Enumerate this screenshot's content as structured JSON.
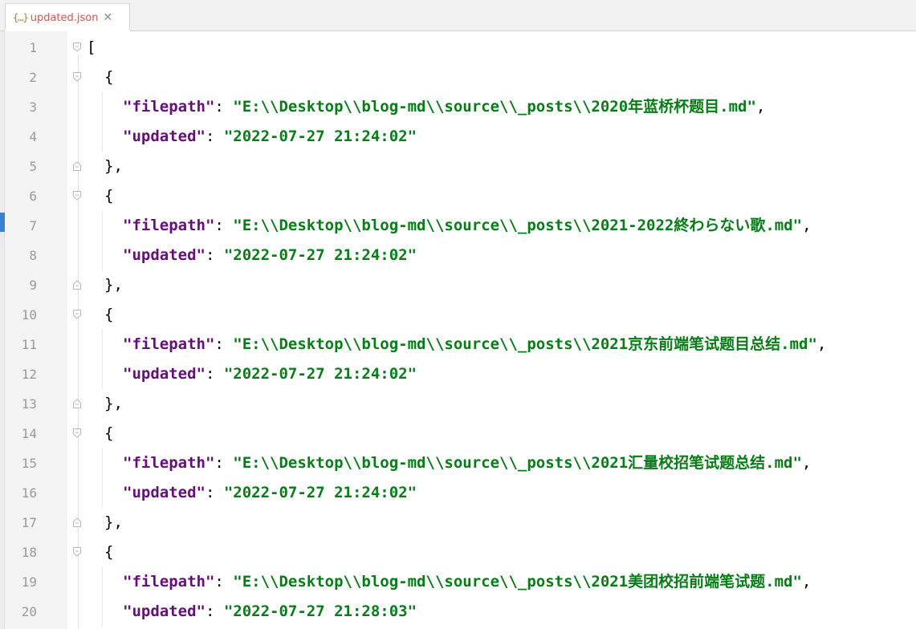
{
  "tab": {
    "icon": "json-file-icon",
    "title": "updated.json",
    "close_icon": "close-icon"
  },
  "editor": {
    "lines": [
      {
        "n": "1",
        "type": "open-array",
        "text": "["
      },
      {
        "n": "2",
        "type": "open-obj",
        "text": "{"
      },
      {
        "n": "3",
        "type": "kv",
        "key": "\"filepath\"",
        "value": "\"E:\\\\Desktop\\\\blog-md\\\\source\\\\_posts\\\\2020年蓝桥杯题目.md\"",
        "comma": ","
      },
      {
        "n": "4",
        "type": "kv",
        "key": "\"updated\"",
        "value": "\"2022-07-27 21:24:02\"",
        "comma": ""
      },
      {
        "n": "5",
        "type": "close-obj",
        "text": "},"
      },
      {
        "n": "6",
        "type": "open-obj",
        "text": "{"
      },
      {
        "n": "7",
        "type": "kv",
        "key": "\"filepath\"",
        "value": "\"E:\\\\Desktop\\\\blog-md\\\\source\\\\_posts\\\\2021-2022終わらない歌.md\"",
        "comma": ","
      },
      {
        "n": "8",
        "type": "kv",
        "key": "\"updated\"",
        "value": "\"2022-07-27 21:24:02\"",
        "comma": ""
      },
      {
        "n": "9",
        "type": "close-obj",
        "text": "},"
      },
      {
        "n": "10",
        "type": "open-obj",
        "text": "{"
      },
      {
        "n": "11",
        "type": "kv",
        "key": "\"filepath\"",
        "value": "\"E:\\\\Desktop\\\\blog-md\\\\source\\\\_posts\\\\2021京东前端笔试题目总结.md\"",
        "comma": ","
      },
      {
        "n": "12",
        "type": "kv",
        "key": "\"updated\"",
        "value": "\"2022-07-27 21:24:02\"",
        "comma": ""
      },
      {
        "n": "13",
        "type": "close-obj",
        "text": "},"
      },
      {
        "n": "14",
        "type": "open-obj",
        "text": "{"
      },
      {
        "n": "15",
        "type": "kv",
        "key": "\"filepath\"",
        "value": "\"E:\\\\Desktop\\\\blog-md\\\\source\\\\_posts\\\\2021汇量校招笔试题总结.md\"",
        "comma": ","
      },
      {
        "n": "16",
        "type": "kv",
        "key": "\"updated\"",
        "value": "\"2022-07-27 21:24:02\"",
        "comma": ""
      },
      {
        "n": "17",
        "type": "close-obj",
        "text": "},"
      },
      {
        "n": "18",
        "type": "open-obj",
        "text": "{"
      },
      {
        "n": "19",
        "type": "kv",
        "key": "\"filepath\"",
        "value": "\"E:\\\\Desktop\\\\blog-md\\\\source\\\\_posts\\\\2021美团校招前端笔试题.md\"",
        "comma": ","
      },
      {
        "n": "20",
        "type": "kv",
        "key": "\"updated\"",
        "value": "\"2022-07-27 21:28:03\"",
        "comma": ""
      }
    ]
  },
  "colors": {
    "key": "#660e7a",
    "string": "#067d17",
    "line_number": "#9a9a9a",
    "tab_title": "#d9534f",
    "gutter_marker": "#3b7ed6"
  }
}
